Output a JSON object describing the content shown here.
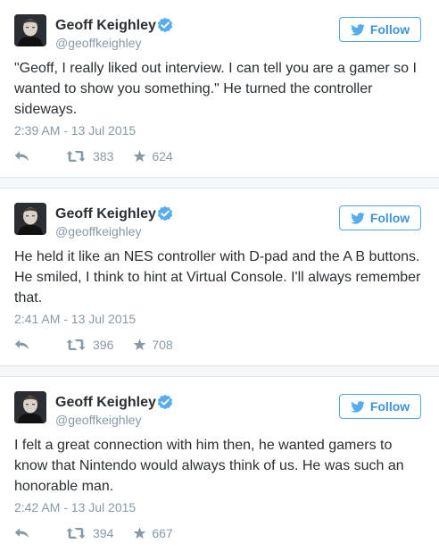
{
  "tweets": [
    {
      "name": "Geoff Keighley",
      "handle": "@geoffkeighley",
      "follow_label": "Follow",
      "text": "\"Geoff, I really liked out interview. I can tell you are a gamer so I wanted to show you something.\" He turned the controller sideways.",
      "timestamp": "2:39 AM - 13 Jul 2015",
      "retweets": "383",
      "likes": "624"
    },
    {
      "name": "Geoff Keighley",
      "handle": "@geoffkeighley",
      "follow_label": "Follow",
      "text": "He held it like an NES controller with D-pad and the A B buttons. He smiled, I think to hint at Virtual Console. I'll always remember that.",
      "timestamp": "2:41 AM - 13 Jul 2015",
      "retweets": "396",
      "likes": "708"
    },
    {
      "name": "Geoff Keighley",
      "handle": "@geoffkeighley",
      "follow_label": "Follow",
      "text": "I felt a great connection with him then, he wanted gamers to know that Nintendo would always think of us. He was such an honorable man.",
      "timestamp": "2:42 AM - 13 Jul 2015",
      "retweets": "394",
      "likes": "667"
    }
  ],
  "icons": {
    "avatar": "avatar-icon",
    "verified": "verified-badge-icon",
    "follow": "twitter-bird-icon",
    "reply": "reply-icon",
    "retweet": "retweet-icon",
    "like": "star-icon"
  },
  "colors": {
    "text": "#292f33",
    "secondary": "#8899a6",
    "accent": "#3b94d9",
    "verified": "#55acee",
    "separator": "#f5f8fa"
  }
}
